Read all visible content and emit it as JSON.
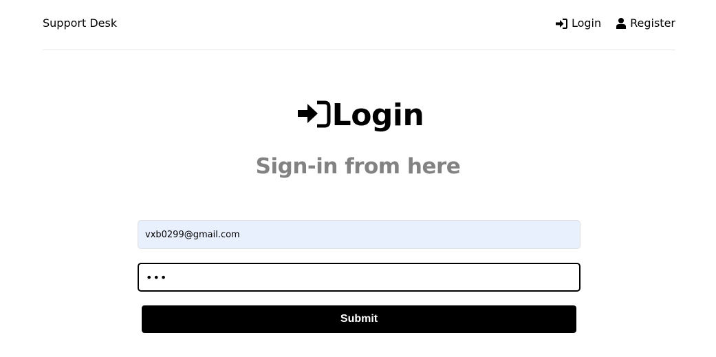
{
  "header": {
    "brand": "Support Desk",
    "nav": {
      "login_label": "Login",
      "register_label": "Register",
      "login_icon": "sign-in-icon",
      "register_icon": "user-icon"
    }
  },
  "main": {
    "title": "Login",
    "title_icon": "sign-in-icon",
    "subtitle": "Sign-in from here"
  },
  "form": {
    "email_value": "vxb0299@gmail.com",
    "password_display": "•••",
    "submit_label": "Submit"
  },
  "colors": {
    "text": "#000000",
    "subtitle": "#828282",
    "autofill_bg": "#e8f0fe",
    "button_bg": "#000000",
    "button_text": "#ffffff"
  }
}
